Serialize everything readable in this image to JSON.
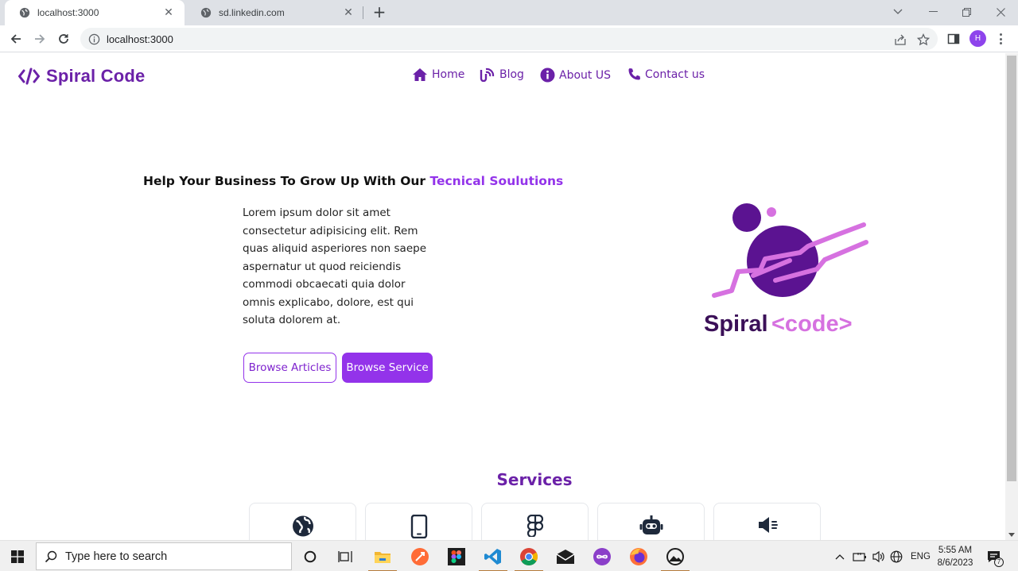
{
  "browser": {
    "tabs": [
      {
        "title": "localhost:3000",
        "active": true
      },
      {
        "title": "sd.linkedin.com",
        "active": false
      }
    ],
    "url": "localhost:3000",
    "profile_initial": "H"
  },
  "site": {
    "brand": "Spiral Code",
    "nav": [
      {
        "label": "Home",
        "icon": "home-icon"
      },
      {
        "label": "Blog",
        "icon": "blog-icon"
      },
      {
        "label": "About US",
        "icon": "info-icon"
      },
      {
        "label": "Contact us",
        "icon": "phone-icon"
      }
    ],
    "hero": {
      "title_prefix": "Help Your Business To Grow Up With Our ",
      "title_highlight": "Tecnical Soulutions",
      "body": "Lorem ipsum dolor sit amet consectetur adipisicing elit. Rem quas aliquid asperiores non saepe aspernatur ut quod reiciendis commodi obcaecati quia dolor omnis explicabo, dolore, est qui soluta dolorem at.",
      "browse_articles": "Browse Articles",
      "browse_service": "Browse Service"
    },
    "logo": {
      "text_main": "Spiral",
      "text_code": "<code>"
    },
    "services": {
      "title": "Services",
      "cards": [
        {
          "icon": "globe-icon"
        },
        {
          "icon": "mobile-icon"
        },
        {
          "icon": "figma-icon"
        },
        {
          "icon": "robot-icon"
        },
        {
          "icon": "megaphone-icon"
        }
      ]
    }
  },
  "taskbar": {
    "search_placeholder": "Type here to search",
    "language": "ENG",
    "time": "5:55 AM",
    "date": "8/6/2023",
    "notification_count": "7"
  },
  "colors": {
    "brand_purple": "#6b21a8",
    "accent_purple": "#9333ea",
    "logo_pink": "#d671e0"
  }
}
